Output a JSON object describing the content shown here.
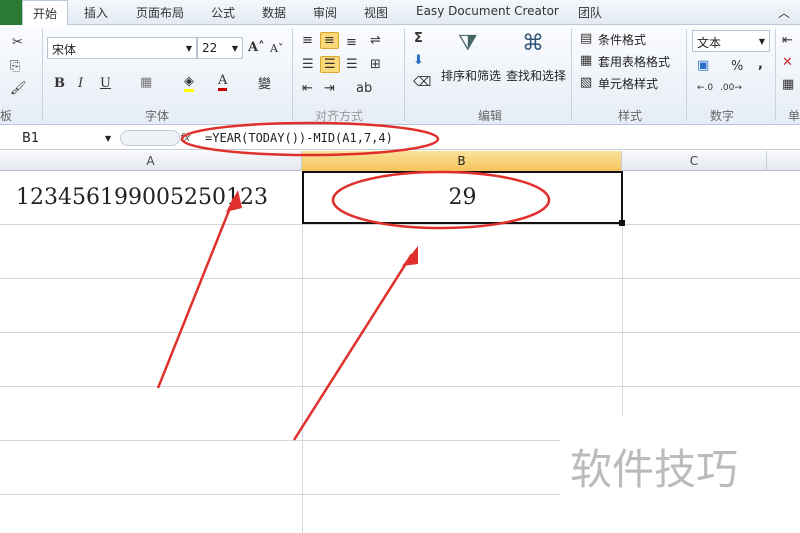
{
  "tabs": [
    "开始",
    "插入",
    "页面布局",
    "公式",
    "数据",
    "审阅",
    "视图",
    "Easy Document Creator",
    "团队"
  ],
  "ribbon": {
    "font_name": "宋体",
    "font_size": "22",
    "number_format": "文本",
    "groups": {
      "clipboard": "板",
      "font": "字体",
      "align": "对齐方式",
      "edit": "编辑",
      "styles": "样式",
      "number": "数字",
      "cells": "单"
    },
    "sort_filter": "排序和筛选",
    "find_select": "查找和选择",
    "cond_format": "条件格式",
    "table_format": "套用表格格式",
    "cell_style": "单元格样式",
    "bold": "B",
    "italic": "I",
    "underline": "U",
    "percent": "%",
    "comma": ","
  },
  "formula_bar": {
    "name_box": "B1",
    "fx": "fx",
    "formula": "=YEAR(TODAY())-MID(A1,7,4)"
  },
  "columns": [
    "A",
    "B",
    "C"
  ],
  "cells": {
    "A1": "123456199005250123",
    "B1": "29"
  },
  "watermark": "软件技巧",
  "annotation_color": "#e0302c"
}
